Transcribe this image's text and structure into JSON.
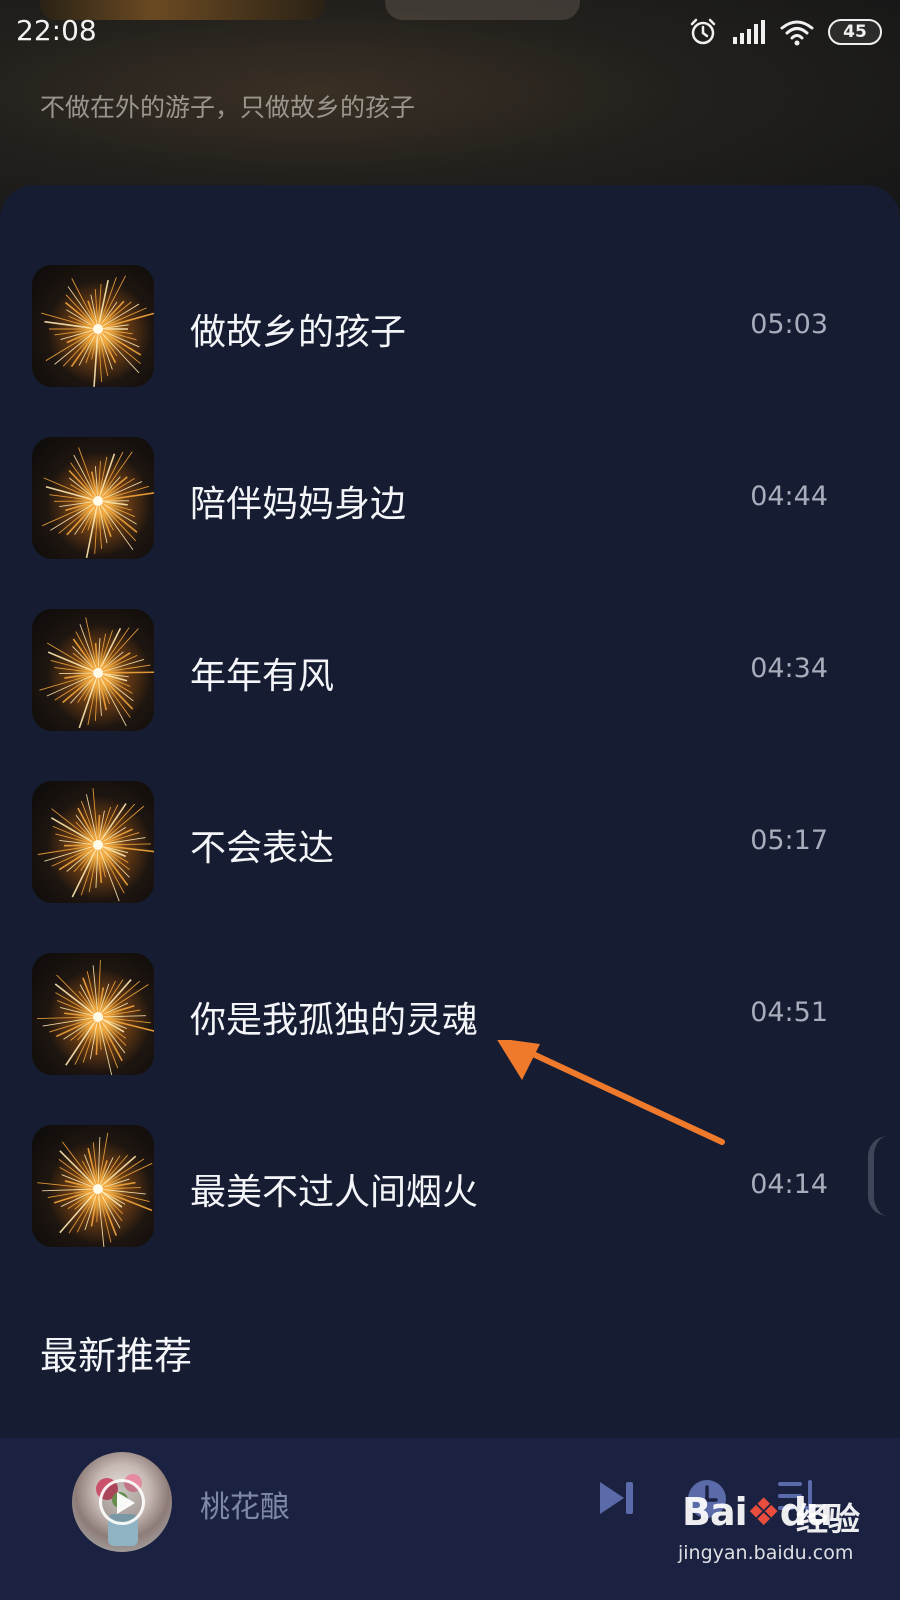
{
  "status_bar": {
    "time": "22:08",
    "battery": "45",
    "icons": [
      "alarm-icon",
      "signal-icon",
      "wifi-icon",
      "battery-icon"
    ]
  },
  "header": {
    "subtitle": "不做在外的游子，只做故乡的孩子"
  },
  "songs": [
    {
      "title": "做故乡的孩子",
      "duration": "05:03"
    },
    {
      "title": "陪伴妈妈身边",
      "duration": "04:44"
    },
    {
      "title": "年年有风",
      "duration": "04:34"
    },
    {
      "title": "不会表达",
      "duration": "05:17"
    },
    {
      "title": "你是我孤独的灵魂",
      "duration": "04:51"
    },
    {
      "title": "最美不过人间烟火",
      "duration": "04:14"
    }
  ],
  "section": {
    "title": "最新推荐"
  },
  "player": {
    "title": "桃花酿",
    "icons": [
      "skip-next-icon",
      "timer-icon",
      "queue-icon"
    ]
  },
  "watermark": {
    "logo_a": "Bai",
    "logo_b": "du",
    "exp": "经验",
    "url": "jingyan.baidu.com"
  },
  "colors": {
    "background": "#161c31",
    "player_bar": "#1b2241",
    "arrow": "#f07a2c",
    "accent_icon": "#5b6aa8"
  }
}
